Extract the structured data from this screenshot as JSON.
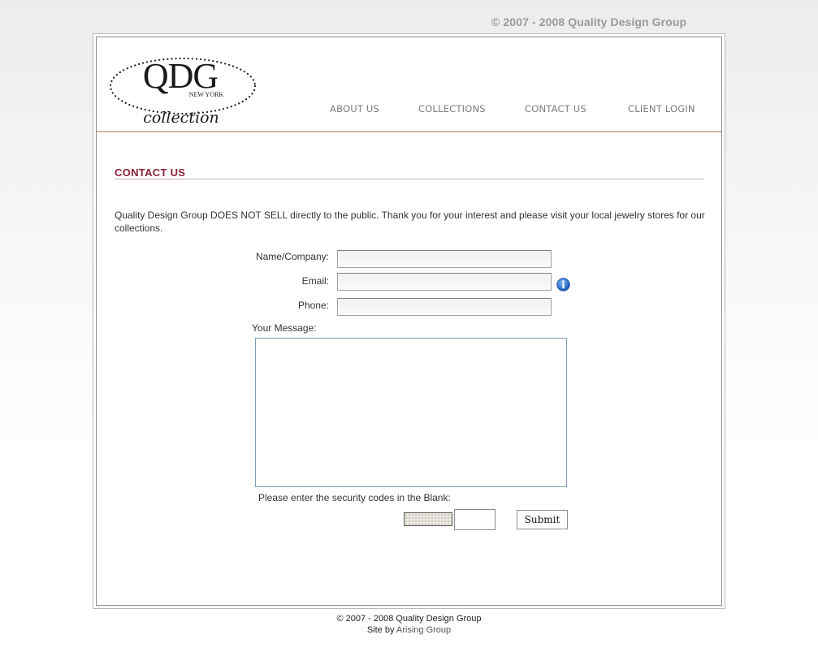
{
  "top_banner": {
    "copyright": "© 2007 - 2008 Quality Design Group"
  },
  "logo": {
    "monogram": "QDG",
    "location": "NEW YORK",
    "word": "collection"
  },
  "nav": {
    "items": [
      {
        "label": "ABOUT US"
      },
      {
        "label": "COLLECTIONS"
      },
      {
        "label": "CONTACT US"
      },
      {
        "label": "CLIENT LOGIN"
      }
    ]
  },
  "main": {
    "title": "CONTACT US",
    "intro": "Quality Design Group DOES NOT SELL directly to the public. Thank you for your interest and please visit your local jewelry stores for our collections."
  },
  "form": {
    "name_label": "Name/Company:",
    "name_value": "",
    "email_label": "Email:",
    "email_value": "",
    "phone_label": "Phone:",
    "phone_value": "",
    "message_label": "Your Message:",
    "message_value": "",
    "security_label": "Please enter the security codes in the Blank:",
    "security_value": "",
    "submit_label": "Submit"
  },
  "footer": {
    "copyright": "© 2007 - 2008 Quality Design Group",
    "credit_prefix": "Site by ",
    "credit_link": "Arising Group"
  },
  "colors": {
    "accent": "#8b2036",
    "nav_text": "#7d7d7d",
    "divider": "#c7b5a8",
    "info_icon": "#1e6fc4"
  }
}
